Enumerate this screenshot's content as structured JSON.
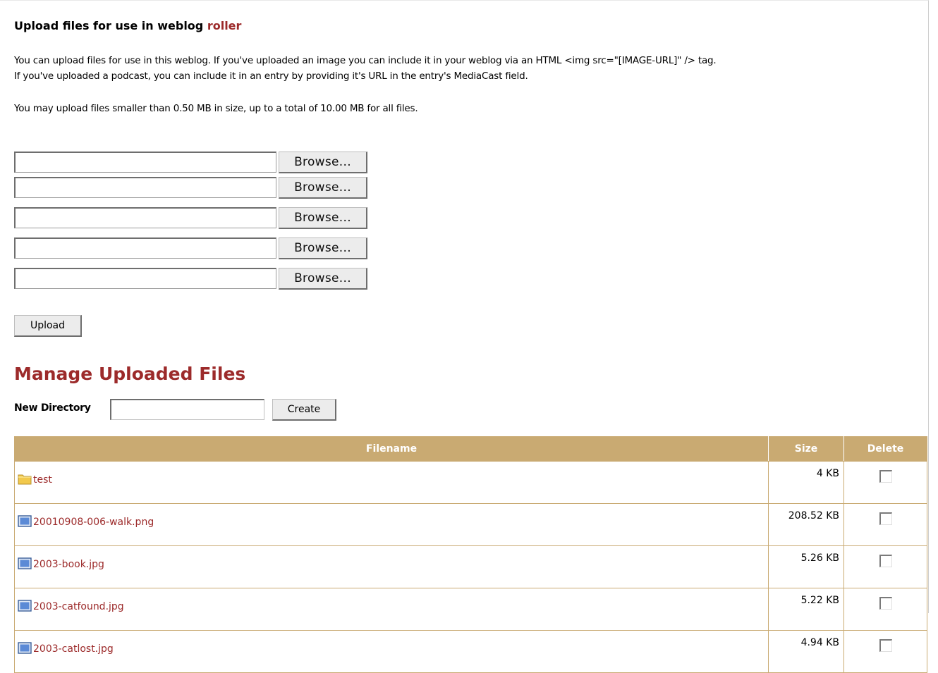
{
  "header": {
    "title_prefix": "Upload files for use in weblog",
    "weblog_name": "roller"
  },
  "intro": {
    "line1": "You can upload files for use in this weblog. If you've uploaded an image you can include it in your weblog via an HTML <img src=\"[IMAGE-URL]\" /> tag.",
    "line2": "If you've uploaded a podcast, you can include it in an entry by providing it's URL in the entry's MediaCast field.",
    "limits": "You may upload files smaller than 0.50 MB in size, up to a total of 10.00 MB for all files."
  },
  "upload_form": {
    "browse_label": "Browse...",
    "upload_label": "Upload",
    "file_fields": [
      {
        "value": ""
      },
      {
        "value": ""
      },
      {
        "value": ""
      },
      {
        "value": ""
      },
      {
        "value": ""
      }
    ]
  },
  "manage": {
    "title": "Manage Uploaded Files",
    "new_directory_label": "New Directory",
    "new_directory_value": "",
    "create_label": "Create"
  },
  "table": {
    "columns": [
      "Filename",
      "Size",
      "Delete"
    ],
    "rows": [
      {
        "name": "test",
        "size": "4 KB",
        "icon": "folder-icon",
        "checked": false
      },
      {
        "name": "20010908-006-walk.png",
        "size": "208.52 KB",
        "icon": "image-file-icon",
        "checked": false
      },
      {
        "name": "2003-book.jpg",
        "size": "5.26 KB",
        "icon": "image-file-icon",
        "checked": false
      },
      {
        "name": "2003-catfound.jpg",
        "size": "5.22 KB",
        "icon": "image-file-icon",
        "checked": false
      },
      {
        "name": "2003-catlost.jpg",
        "size": "4.94 KB",
        "icon": "image-file-icon",
        "checked": false
      }
    ]
  },
  "colors": {
    "accent": "#9c2a2a",
    "table_header": "#c9aa72",
    "folder": "#f2c94c"
  }
}
